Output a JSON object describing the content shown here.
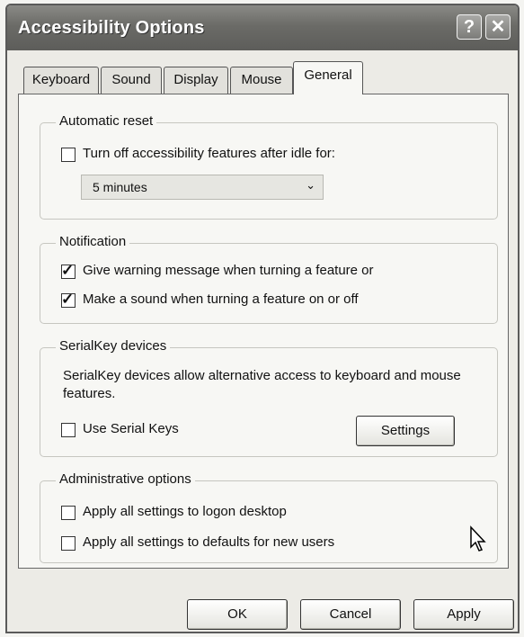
{
  "window": {
    "title": "Accessibility Options",
    "help_icon": "help-icon",
    "close_icon": "close-icon"
  },
  "tabs": [
    {
      "label": "Keyboard",
      "active": false
    },
    {
      "label": "Sound",
      "active": false
    },
    {
      "label": "Display",
      "active": false
    },
    {
      "label": "Mouse",
      "active": false
    },
    {
      "label": "General",
      "active": true
    }
  ],
  "automatic_reset": {
    "title": "Automatic reset",
    "idle_checkbox": {
      "label": "Turn off accessibility features after idle for:",
      "checked": false
    },
    "idle_select": {
      "value": "5 minutes"
    }
  },
  "notification": {
    "title": "Notification",
    "warning_checkbox": {
      "label": "Give warning message when turning a feature or",
      "checked": true
    },
    "sound_checkbox": {
      "label": "Make a sound when turning a feature on or off",
      "checked": true
    }
  },
  "serialkey": {
    "title": "SerialKey devices",
    "description": "SerialKey devices allow alternative access to keyboard and mouse features.",
    "use_checkbox": {
      "label": "Use Serial Keys",
      "checked": false
    },
    "settings_button": "Settings"
  },
  "admin": {
    "title": "Administrative options",
    "logon_checkbox": {
      "label": "Apply all settings to logon desktop",
      "checked": false
    },
    "defaults_checkbox": {
      "label": "Apply all settings to defaults for new users",
      "checked": false
    }
  },
  "buttons": {
    "ok": "OK",
    "cancel": "Cancel",
    "apply": "Apply"
  },
  "check_glyph": "✓"
}
